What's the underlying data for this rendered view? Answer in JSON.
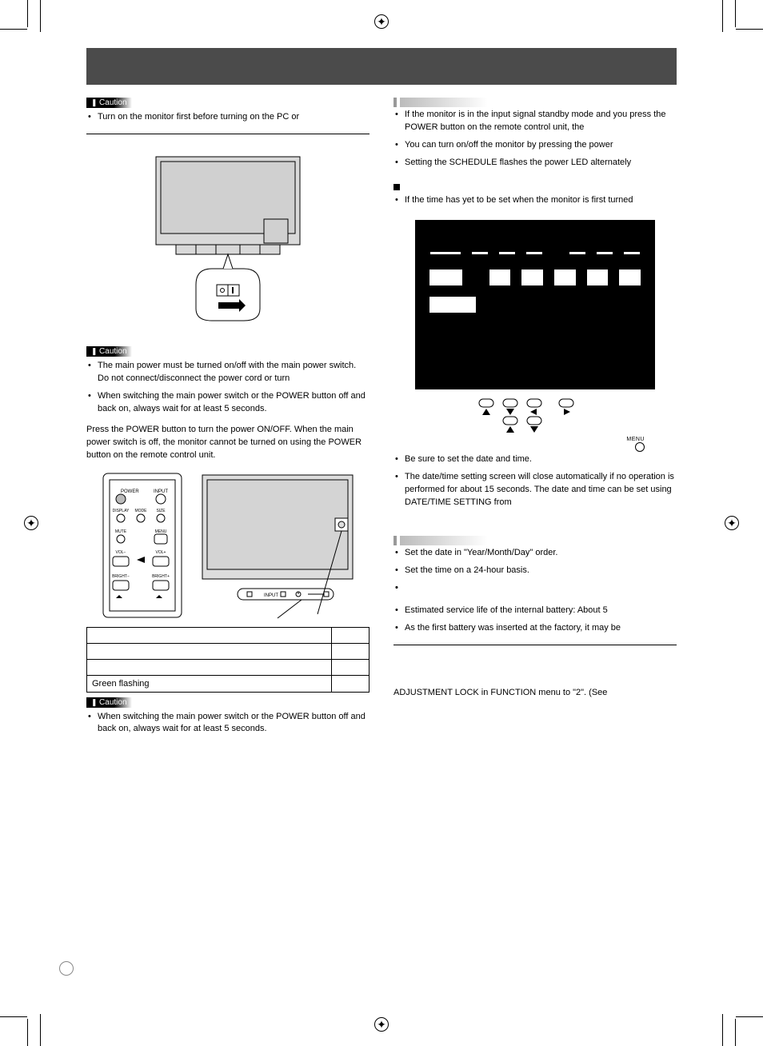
{
  "header": {
    "title": ""
  },
  "left_column": {
    "caution1": {
      "label": "Caution",
      "items": [
        "Turn on the monitor first before turning on the PC or"
      ]
    },
    "caution2": {
      "label": "Caution",
      "items": [
        "The main power must be turned on/off with the main power switch. Do not connect/disconnect the power cord or turn",
        "When switching the main power switch or the POWER button off and back on, always wait for at least 5 seconds."
      ]
    },
    "power_para": "Press the POWER button to turn the power ON/OFF. When the main power switch is off, the monitor cannot be turned on using the POWER button on the remote control unit.",
    "remote_labels": {
      "power": "POWER",
      "input": "INPUT",
      "display": "DISPLAY",
      "mode": "MODE",
      "size": "SIZE",
      "mute": "MUTE",
      "menu": "MENU",
      "volm": "VOL−",
      "volp": "VOL+",
      "brightm": "BRIGHT−",
      "brightp": "BRIGHT+"
    },
    "monitor_labels": {
      "input": "INPUT"
    },
    "table": {
      "rows": [
        [
          "",
          ""
        ],
        [
          "",
          ""
        ],
        [
          "",
          ""
        ],
        [
          "Green flashing",
          ""
        ]
      ]
    },
    "caution3": {
      "label": "Caution",
      "items": [
        "When switching the main power switch or the POWER button off and back on, always wait for at least 5 seconds."
      ]
    }
  },
  "right_column": {
    "tips1_items": [
      "If the monitor is in the input signal standby mode and you press the POWER button on the remote control unit, the",
      "You can turn on/off the monitor by pressing the power",
      "Setting the SCHEDULE flashes the power LED alternately"
    ],
    "square_items": [
      "If the time has yet to be set when the monitor is first turned"
    ],
    "after_osd_items": [
      "Be sure to set the date and time.",
      "The date/time setting screen will close automatically if no operation is performed for about 15 seconds. The date and time can be set using DATE/TIME SETTING from"
    ],
    "tips2_items": [
      "Set the date in \"Year/Month/Day\" order.",
      "Set the time on a 24-hour basis.",
      "",
      ""
    ],
    "battery_items": [
      "Estimated service life of the internal battery: About 5",
      "As the first battery was inserted at the factory, it may be"
    ],
    "footer_line": "ADJUSTMENT LOCK in FUNCTION menu to \"2\". (See",
    "menu_label": "MENU"
  }
}
